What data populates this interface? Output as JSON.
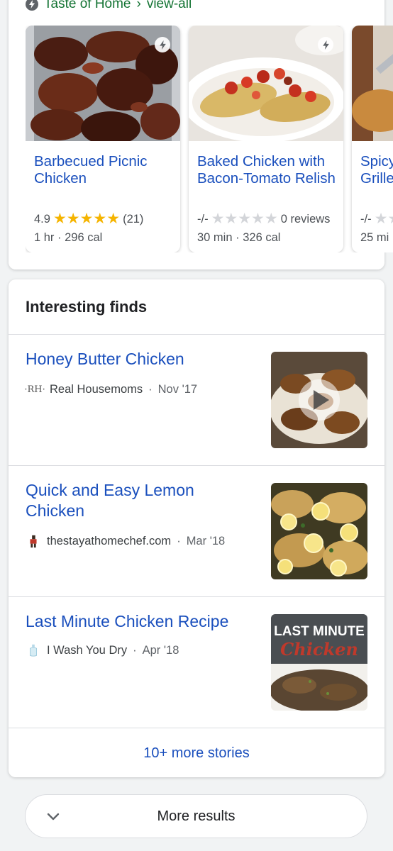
{
  "source": {
    "site": "Taste of Home",
    "separator": "›",
    "link": "view-all",
    "icon": "amp-lightning-icon"
  },
  "recipes": [
    {
      "title": "Barbecued Picnic Chicken",
      "rating": "4.9",
      "stars_filled": 5,
      "stars_text": "★★★★★",
      "reviews": "(21)",
      "time": "1 hr",
      "calories": "296 cal",
      "icon": "amp-lightning-icon"
    },
    {
      "title": "Baked Chicken with Bacon-Tomato Relish",
      "rating": "-/-",
      "stars_filled": 0,
      "stars_text": "★★★★★",
      "reviews": "0 reviews",
      "time": "30 min",
      "calories": "326 cal",
      "icon": "amp-lightning-icon"
    },
    {
      "title": "Spicy Grille",
      "rating": "-/-",
      "stars_filled": 0,
      "stars_text": "★★★★★",
      "reviews": "",
      "time": "25 mi",
      "calories": ""
    }
  ],
  "meta_separator": "·",
  "finds": {
    "heading": "Interesting finds",
    "stories": [
      {
        "title": "Honey Butter Chicken",
        "publisher": "Real Housemoms",
        "date": "Nov '17",
        "favicon_text": "·RH·",
        "has_video": true
      },
      {
        "title": "Quick and Easy Lemon Chicken",
        "publisher": "thestayathomechef.com",
        "date": "Mar '18",
        "favicon": "chef-icon"
      },
      {
        "title": "Last Minute Chicken Recipe",
        "publisher": "I Wash You Dry",
        "date": "Apr '18",
        "favicon": "bottle-icon",
        "thumb_text_1": "LAST MINUTE",
        "thumb_text_2": "Chicken"
      }
    ],
    "more_stories": "10+ more stories"
  },
  "more_results": {
    "label": "More results",
    "icon": "chevron-down-icon"
  },
  "colors": {
    "link": "#1a4fbd",
    "source_green": "#137333",
    "star_gold": "#f5b400",
    "star_grey": "#d3d5d9"
  }
}
